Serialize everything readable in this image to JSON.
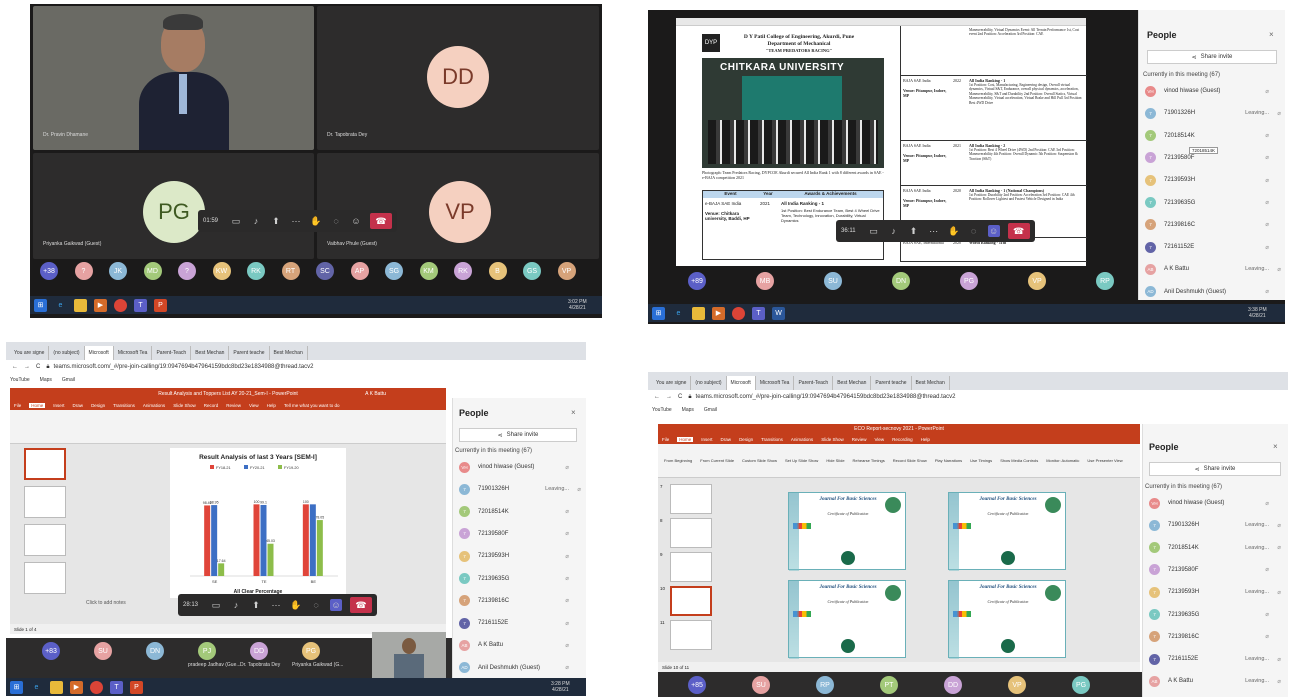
{
  "p1": {
    "tiles": [
      {
        "name": "Dr. Pravin Dhamane"
      },
      {
        "initials": "DD",
        "name": "Dr. Tapobrata Dey"
      },
      {
        "initials": "PG",
        "name": "Priyanka Gaikwad (Guest)"
      },
      {
        "initials": "VP",
        "name": "Vaibhav Phule (Guest)"
      }
    ],
    "timer": "01:59",
    "bar": [
      "+38",
      "?",
      "JK",
      "MD",
      "?",
      "KW",
      "RK",
      "RT",
      "SC",
      "AP",
      "SG",
      "KM",
      "RK",
      "B",
      "GS",
      "VP"
    ],
    "clock_time": "3:02 PM",
    "clock_date": "4/28/21"
  },
  "p2": {
    "doc": {
      "college": "D Y Patil College of Engineering, Akurdi, Pune",
      "dept": "Department of Mechanical",
      "team": "\"TEAM PREDATORS RACING\"",
      "banner": "CHITKARA UNIVERSITY",
      "caption": "Photograph: Team Predators Racing, DYPCOE Akurdi secured All India Rank 1 with 8 different awards in SAE - e-BAJA competition 2021",
      "th": [
        "Event",
        "Year",
        "Awards & Achievements"
      ],
      "row_event": "e-BAJA SAE India",
      "row_venue": "Venue: Chitkara university, Baddi, HP",
      "row_year": "2021",
      "row_award": "All India Ranking - 1",
      "row_detail": "1st Position: Best Endurance Team, Best 4 Wheel Drive Team, Technology, Innovation, Durability, Virtual Dynamics",
      "right_rows": [
        {
          "event": "",
          "venue": "",
          "year": "",
          "title": "",
          "detail": "Maneuverability, Virtual Dynamics Event: All Terrain Performance 1st, Cost event 2nd Position: Acceleration 3rd Position: CAE"
        },
        {
          "event": "BAJA SAE India",
          "venue": "Venue: Pitampur, Indore, MP",
          "year": "2022",
          "title": "All India Ranking - 1",
          "detail": "1st Position: Cost, Manufacturing, Engineering design, Overall virtual dynamics, Virtual S&T, Endurance, overall physical dynamics, acceleration, Maneuverability, S&T and Durability 2nd Position: Overall Statics, Virtual Maneuverability, Virtual acceleration, Virtual Brake and Hill Pull 3rd Position: Best 4WD Drive"
        },
        {
          "event": "BAJA SAE India",
          "venue": "Venue: Pitampur, Indore, MP",
          "year": "2021",
          "title": "All India Ranking - 2",
          "detail": "1st Position: Best 4 Wheel Drive (4WD) 2nd Position: CAE 3rd Position: Maneuverability 4th Position: Overall Dynamic 5th Position: Suspension & Traction (S&T)"
        },
        {
          "event": "BAJA SAE India",
          "venue": "Venue: Pitampur, Indore, MP",
          "year": "2020",
          "title": "All India Ranking - 1 (National Champions)",
          "detail": "1st Position: Durability 2nd Position: Acceleration 3rd Position: CAE 4th Position: Rollover Lightest and Fastest Vehicle Designed in India"
        },
        {
          "event": "BAJA SAE, International",
          "venue": "",
          "year": "2020",
          "title": "World Ranking - 11th",
          "detail": ""
        }
      ]
    },
    "timer": "36:11",
    "people": {
      "title": "People",
      "share": "Share invite",
      "current": "Currently in this meeting (67)",
      "rows": [
        {
          "init": "VH",
          "name": "vinod hiwase (Guest)",
          "status": ""
        },
        {
          "init": "7",
          "name": "71901326H",
          "status": "Leaving..."
        },
        {
          "init": "7",
          "name": "72018514K",
          "status": ""
        },
        {
          "init": "7",
          "name": "72139580F",
          "status": ""
        },
        {
          "init": "7",
          "name": "72139593H",
          "status": ""
        },
        {
          "init": "7",
          "name": "72139635G",
          "status": ""
        },
        {
          "init": "7",
          "name": "72139816C",
          "status": ""
        },
        {
          "init": "7",
          "name": "72161152E",
          "status": ""
        },
        {
          "init": "AB",
          "name": "A K Battu",
          "status": "Leaving..."
        },
        {
          "init": "AD",
          "name": "Anil Deshmukh (Guest)",
          "status": ""
        }
      ],
      "tooltip": "72018514K"
    },
    "bar": [
      "+89",
      "MB",
      "SU",
      "DN",
      "PG",
      "VP",
      "RP"
    ],
    "clock_time": "3:38 PM",
    "clock_date": "4/28/21"
  },
  "p3": {
    "tabs": [
      "You are signe",
      "(no subject)",
      "Microsoft",
      "Microsoft Tea",
      "Parent-Teach",
      "Best Mechan",
      "Parent teache",
      "Best Mechan"
    ],
    "url": "teams.microsoft.com/_#/pre-join-calling/19:0947694b47964159bdc8bd23e1834988@thread.tacv2",
    "bookmarks": [
      "YouTube",
      "Maps",
      "Gmail"
    ],
    "ppt_title": "Result Analysis and Toppers List AY 20-21_Sem-I - PowerPoint",
    "ppt_user": "A K Battu",
    "ppt_tabs": [
      "File",
      "Home",
      "Insert",
      "Draw",
      "Design",
      "Transitions",
      "Animations",
      "Slide Show",
      "Record",
      "Review",
      "View",
      "Help",
      "Tell me what you want to do"
    ],
    "chart_data": {
      "type": "bar",
      "title": "Result Analysis of last 3 Years [SEM-I]",
      "series": [
        {
          "name": "FY18-21",
          "values": [
            98.46,
            100,
            100
          ]
        },
        {
          "name": "FY20-21",
          "values": [
            98.95,
            99.1,
            100
          ]
        },
        {
          "name": "FY19-20",
          "values": [
            17.64,
            45.03,
            78.05
          ]
        }
      ],
      "value_labels": [
        [
          "98.46",
          "100",
          "100"
        ],
        [
          "98.95",
          "99.1",
          ""
        ],
        [
          "17.64",
          "45.03",
          "78.05"
        ]
      ],
      "categories": [
        "SE",
        "TE",
        "BE"
      ],
      "xlabel": "All Clear Percentage",
      "ylim": [
        0,
        120
      ]
    },
    "notes_placeholder": "Click to add notes",
    "status": "Slide 1 of 4",
    "timer": "28:13",
    "people": {
      "title": "People",
      "share": "Share invite",
      "current": "Currently in this meeting (67)",
      "rows": [
        {
          "init": "VH",
          "name": "vinod hiwase (Guest)",
          "status": ""
        },
        {
          "init": "7",
          "name": "71901326H",
          "status": "Leaving..."
        },
        {
          "init": "7",
          "name": "72018514K",
          "status": ""
        },
        {
          "init": "7",
          "name": "72139580F",
          "status": ""
        },
        {
          "init": "7",
          "name": "72139593H",
          "status": ""
        },
        {
          "init": "7",
          "name": "72139635G",
          "status": ""
        },
        {
          "init": "7",
          "name": "72139816C",
          "status": ""
        },
        {
          "init": "7",
          "name": "72161152E",
          "status": ""
        },
        {
          "init": "AB",
          "name": "A K Battu",
          "status": ""
        },
        {
          "init": "AD",
          "name": "Anil Deshmukh (Guest)",
          "status": ""
        }
      ]
    },
    "bar": [
      {
        "init": "+83",
        "name": ""
      },
      {
        "init": "SU",
        "name": ""
      },
      {
        "init": "DN",
        "name": ""
      },
      {
        "init": "PJ",
        "name": "pradeep Jadhav (Gue..."
      },
      {
        "init": "DD",
        "name": "Dr. Tapobrata Dey"
      },
      {
        "init": "PG",
        "name": "Priyanka Gaikwad (G..."
      }
    ],
    "clock_time": "3:28 PM",
    "clock_date": "4/28/21"
  },
  "p4": {
    "tabs": [
      "You are signe",
      "(no subject)",
      "Microsoft",
      "Microsoft Tea",
      "Parent-Teach",
      "Best Mechan",
      "Parent teache",
      "Best Mechan"
    ],
    "url": "teams.microsoft.com/_#/pre-join-calling/19:0947694b47964159bdc8bd23e1834988@thread.tacv2",
    "bookmarks": [
      "YouTube",
      "Maps",
      "Gmail"
    ],
    "ppt_title": "ECO Report-secnovy 2021 - PowerPoint",
    "ppt_tabs": [
      "File",
      "Home",
      "Insert",
      "Draw",
      "Design",
      "Transitions",
      "Animations",
      "Slide Show",
      "Review",
      "View",
      "Recording",
      "Help"
    ],
    "ribbon": [
      "From Beginning",
      "From Current Slide",
      "Custom Slide Show",
      "Set Up Slide Show",
      "Hide Slide",
      "Rehearse Timings",
      "Record Slide Show",
      "Play Narrations",
      "Use Timings",
      "Show Media Controls",
      "Monitor: Automatic",
      "Use Presenter View"
    ],
    "cert_title": "Journal For Basic Sciences",
    "cert_sub": "Certificate of Publication",
    "slide_nums": [
      "7",
      "8",
      "9",
      "10",
      "11"
    ],
    "status": "Slide 10 of 11",
    "people": {
      "title": "People",
      "share": "Share invite",
      "current": "Currently in this meeting (67)",
      "rows": [
        {
          "init": "VH",
          "name": "vinod hiwase (Guest)",
          "status": ""
        },
        {
          "init": "7",
          "name": "71901326H",
          "status": "Leaving..."
        },
        {
          "init": "7",
          "name": "72018514K",
          "status": "Leaving..."
        },
        {
          "init": "7",
          "name": "72139580F",
          "status": ""
        },
        {
          "init": "7",
          "name": "72139593H",
          "status": "Leaving..."
        },
        {
          "init": "7",
          "name": "72139635G",
          "status": ""
        },
        {
          "init": "7",
          "name": "72139816C",
          "status": ""
        },
        {
          "init": "7",
          "name": "72161152E",
          "status": "Leaving..."
        },
        {
          "init": "AB",
          "name": "A K Battu",
          "status": "Leaving..."
        }
      ]
    },
    "bar": [
      "+85",
      "SU",
      "RP",
      "PT",
      "DD",
      "VP",
      "PG"
    ]
  },
  "colors": {
    "teams_dark": "#2d2c2c",
    "hangup": "#c4314b",
    "ppt_red": "#c43e1c",
    "taskbar": "#1f2b3c",
    "bar_red": "#e0453a",
    "bar_blue": "#3d6fc4",
    "bar_green": "#8dbd4a",
    "avatar_peach": "#f5d0c0",
    "avatar_green": "#dce9c8"
  }
}
